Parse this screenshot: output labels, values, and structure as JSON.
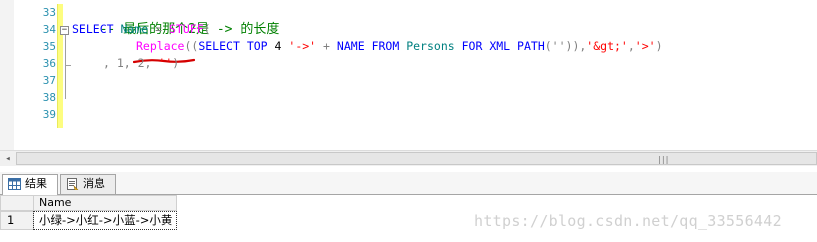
{
  "editor": {
    "line_numbers": [
      "33",
      "34",
      "35",
      "36",
      "37",
      "38",
      "39"
    ],
    "line33": {
      "comment": "-- 最后的那个2是 -> 的长度"
    },
    "line34": {
      "kw1": "SELECT",
      "ident": "Name",
      "eq": "=",
      "fn": "STUFF",
      "paren": "("
    },
    "line35": {
      "fn": "Replace",
      "p1": "((",
      "kw_select": "SELECT",
      "kw_top": "TOP",
      "num": "4",
      "str1": "'->'",
      "plus": "+",
      "name": "NAME",
      "kw_from": "FROM",
      "table": "Persons",
      "kw_for": "FOR",
      "kw_xml": "XML",
      "kw_path": "PATH",
      "p2": "('')),",
      "str2": "'&gt;'",
      "comma": ",",
      "str3": "'>'",
      "p3": ")"
    },
    "line36": {
      "text_a": ", 1, 2, ",
      "str": "''",
      "text_b": ")"
    }
  },
  "scrollbar": {
    "left_arrow": "◂",
    "grip": "|||"
  },
  "results": {
    "tabs": [
      {
        "label": "结果",
        "icon": "grid-icon"
      },
      {
        "label": "消息",
        "icon": "message-icon"
      }
    ],
    "grid": {
      "column_header": "Name",
      "rows": [
        {
          "row_number": "1",
          "name": "小绿->小红->小蓝->小黄"
        }
      ]
    }
  },
  "watermark": "https://blog.csdn.net/qq_33556442",
  "colors": {
    "keyword": "#0000ff",
    "comment": "#008000",
    "string": "#ff0000",
    "function": "#ff00ff",
    "identifier": "#008080",
    "line_number": "#2b91af",
    "change_bar": "#fdfd80",
    "squiggle": "#d40000"
  }
}
